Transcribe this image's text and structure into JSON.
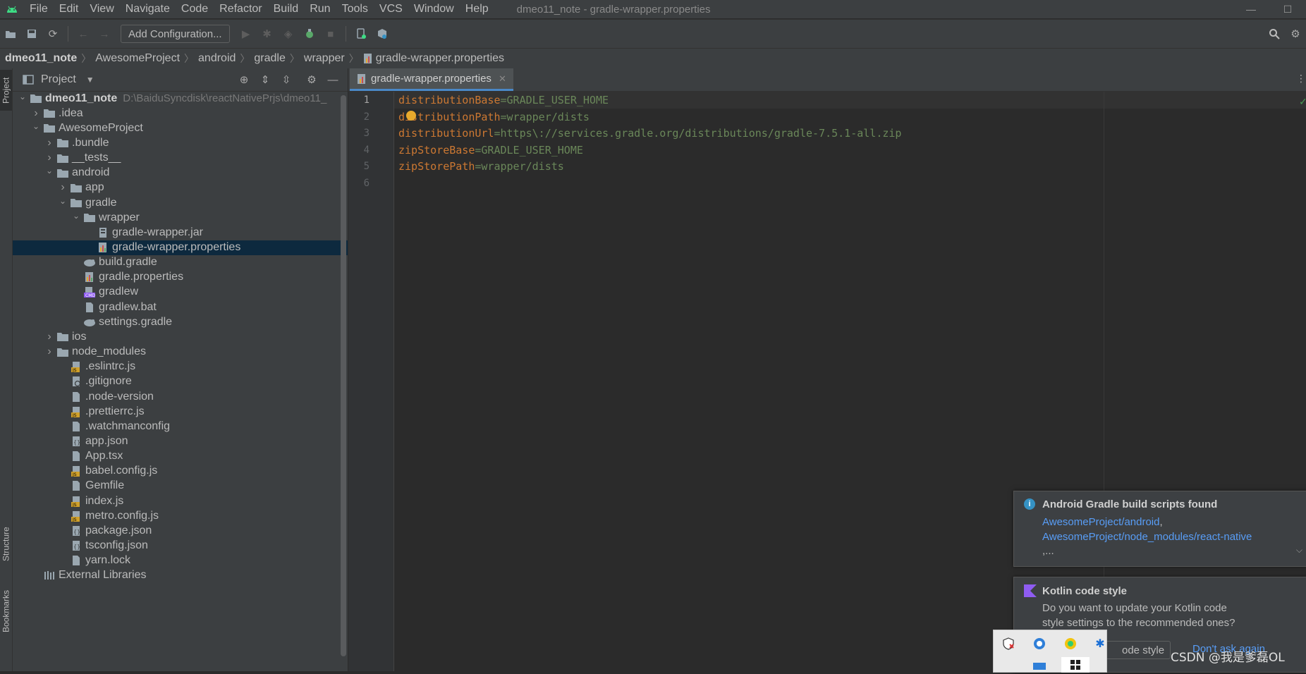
{
  "menubar": {
    "items": [
      "File",
      "Edit",
      "View",
      "Navigate",
      "Code",
      "Refactor",
      "Build",
      "Run",
      "Tools",
      "VCS",
      "Window",
      "Help"
    ],
    "title": "dmeo11_note - gradle-wrapper.properties",
    "minimize": "—",
    "maximize": "☐"
  },
  "toolbar": {
    "add_configuration": "Add Configuration..."
  },
  "breadcrumb": [
    "dmeo11_note",
    "AwesomeProject",
    "android",
    "gradle",
    "wrapper",
    "gradle-wrapper.properties"
  ],
  "side_tabs": {
    "project": "Project",
    "structure": "Structure",
    "bookmarks": "Bookmarks"
  },
  "project_panel": {
    "title": "Project",
    "tree": [
      {
        "label": "dmeo11_note",
        "path": "D:\\BaiduSyncdisk\\reactNativePrjs\\dmeo11_",
        "depth": 0,
        "arrow": "open",
        "icon": "folder"
      },
      {
        "label": ".idea",
        "depth": 1,
        "arrow": "closed",
        "icon": "folder"
      },
      {
        "label": "AwesomeProject",
        "depth": 1,
        "arrow": "open",
        "icon": "folder"
      },
      {
        "label": ".bundle",
        "depth": 2,
        "arrow": "closed",
        "icon": "folder"
      },
      {
        "label": "__tests__",
        "depth": 2,
        "arrow": "closed",
        "icon": "folder"
      },
      {
        "label": "android",
        "depth": 2,
        "arrow": "open",
        "icon": "folder"
      },
      {
        "label": "app",
        "depth": 3,
        "arrow": "closed",
        "icon": "folder"
      },
      {
        "label": "gradle",
        "depth": 3,
        "arrow": "open",
        "icon": "folder"
      },
      {
        "label": "wrapper",
        "depth": 4,
        "arrow": "open",
        "icon": "folder"
      },
      {
        "label": "gradle-wrapper.jar",
        "depth": 5,
        "arrow": "none",
        "icon": "jar"
      },
      {
        "label": "gradle-wrapper.properties",
        "depth": 5,
        "arrow": "none",
        "icon": "props",
        "selected": true
      },
      {
        "label": "build.gradle",
        "depth": 4,
        "arrow": "none",
        "icon": "gradle"
      },
      {
        "label": "gradle.properties",
        "depth": 4,
        "arrow": "none",
        "icon": "props"
      },
      {
        "label": "gradlew",
        "depth": 4,
        "arrow": "none",
        "icon": "shell"
      },
      {
        "label": "gradlew.bat",
        "depth": 4,
        "arrow": "none",
        "icon": "file"
      },
      {
        "label": "settings.gradle",
        "depth": 4,
        "arrow": "none",
        "icon": "gradle"
      },
      {
        "label": "ios",
        "depth": 2,
        "arrow": "closed",
        "icon": "folder"
      },
      {
        "label": "node_modules",
        "depth": 2,
        "arrow": "closed",
        "icon": "folder"
      },
      {
        "label": ".eslintrc.js",
        "depth": 3,
        "arrow": "none",
        "icon": "js"
      },
      {
        "label": ".gitignore",
        "depth": 3,
        "arrow": "none",
        "icon": "ignore"
      },
      {
        "label": ".node-version",
        "depth": 3,
        "arrow": "none",
        "icon": "file"
      },
      {
        "label": ".prettierrc.js",
        "depth": 3,
        "arrow": "none",
        "icon": "js"
      },
      {
        "label": ".watchmanconfig",
        "depth": 3,
        "arrow": "none",
        "icon": "file"
      },
      {
        "label": "app.json",
        "depth": 3,
        "arrow": "none",
        "icon": "json"
      },
      {
        "label": "App.tsx",
        "depth": 3,
        "arrow": "none",
        "icon": "file"
      },
      {
        "label": "babel.config.js",
        "depth": 3,
        "arrow": "none",
        "icon": "js"
      },
      {
        "label": "Gemfile",
        "depth": 3,
        "arrow": "none",
        "icon": "file"
      },
      {
        "label": "index.js",
        "depth": 3,
        "arrow": "none",
        "icon": "js"
      },
      {
        "label": "metro.config.js",
        "depth": 3,
        "arrow": "none",
        "icon": "js"
      },
      {
        "label": "package.json",
        "depth": 3,
        "arrow": "none",
        "icon": "json"
      },
      {
        "label": "tsconfig.json",
        "depth": 3,
        "arrow": "none",
        "icon": "json"
      },
      {
        "label": "yarn.lock",
        "depth": 3,
        "arrow": "none",
        "icon": "file"
      },
      {
        "label": "External Libraries",
        "depth": 1,
        "arrow": "none",
        "icon": "lib"
      }
    ]
  },
  "editor": {
    "tab": "gradle-wrapper.properties",
    "current_line": 1,
    "lines": [
      {
        "n": "1",
        "key": "distributionBase",
        "sep": "=",
        "val": "GRADLE_USER_HOME"
      },
      {
        "n": "2",
        "key": "distributionPath",
        "sep": "=",
        "val": "wrapper/dists"
      },
      {
        "n": "3",
        "key": "distributionUrl",
        "sep": "=",
        "val": "https\\://services.gradle.org/distributions/gradle-7.5.1-all.zip"
      },
      {
        "n": "4",
        "key": "zipStoreBase",
        "sep": "=",
        "val": "GRADLE_USER_HOME"
      },
      {
        "n": "5",
        "key": "zipStorePath",
        "sep": "=",
        "val": "wrapper/dists"
      },
      {
        "n": "6",
        "key": "",
        "sep": "",
        "val": ""
      }
    ]
  },
  "notifications": {
    "gradle": {
      "title": "Android Gradle build scripts found",
      "link1": "AwesomeProject/android",
      "link1_suffix": ",",
      "link2": "AwesomeProject/node_modules/react-native",
      "more": ",..."
    },
    "kotlin": {
      "title": "Kotlin code style",
      "text1": "Do you want to update your Kotlin code",
      "text2": "style settings to the recommended ones?",
      "action1": "ode style",
      "action2": "Don't ask again"
    }
  },
  "watermark": "CSDN @我是爹磊OL",
  "colors": {
    "accent": "#4a88c7",
    "key": "#cc7832",
    "value": "#6a8759",
    "link": "#589df6",
    "selection": "#0d293e"
  }
}
